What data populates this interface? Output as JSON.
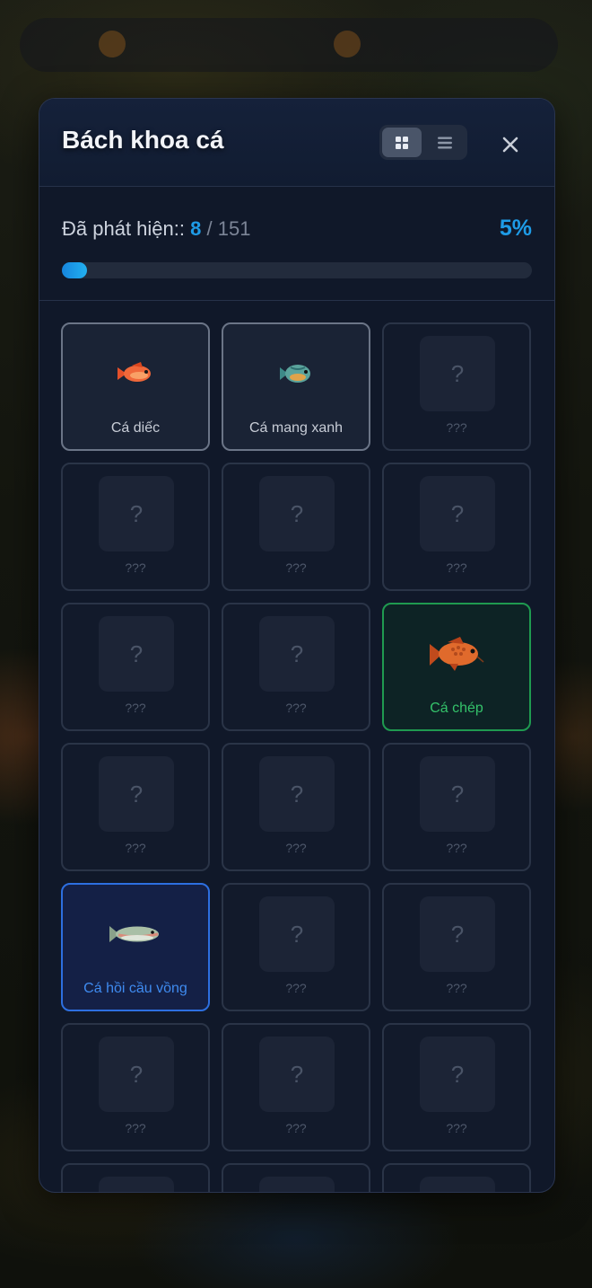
{
  "modal": {
    "title": "Bách khoa cá"
  },
  "progress": {
    "label": "Đã phát hiện::",
    "discovered": "8",
    "separator": "/",
    "total": "151",
    "percent_text": "5%",
    "fraction": 0.05
  },
  "cards": [
    {
      "label": "Cá diếc",
      "state": "found",
      "fish": "small-goldfish"
    },
    {
      "label": "Cá mang xanh",
      "state": "found",
      "fish": "bluegill"
    },
    {
      "label": "???",
      "state": "locked",
      "icon": "?"
    },
    {
      "label": "???",
      "state": "locked",
      "icon": "?"
    },
    {
      "label": "???",
      "state": "locked",
      "icon": "?"
    },
    {
      "label": "???",
      "state": "locked",
      "icon": "?"
    },
    {
      "label": "???",
      "state": "locked",
      "icon": "?"
    },
    {
      "label": "???",
      "state": "locked",
      "icon": "?"
    },
    {
      "label": "Cá chép",
      "state": "green",
      "fish": "carp"
    },
    {
      "label": "???",
      "state": "locked",
      "icon": "?"
    },
    {
      "label": "???",
      "state": "locked",
      "icon": "?"
    },
    {
      "label": "???",
      "state": "locked",
      "icon": "?"
    },
    {
      "label": "Cá hồi cầu vồng",
      "state": "blue",
      "fish": "rainbow-trout"
    },
    {
      "label": "???",
      "state": "locked",
      "icon": "?"
    },
    {
      "label": "???",
      "state": "locked",
      "icon": "?"
    },
    {
      "label": "???",
      "state": "locked",
      "icon": "?"
    },
    {
      "label": "???",
      "state": "locked",
      "icon": "?"
    },
    {
      "label": "???",
      "state": "locked",
      "icon": "?"
    },
    {
      "label": "",
      "state": "locked",
      "icon": ""
    },
    {
      "label": "",
      "state": "locked",
      "icon": ""
    },
    {
      "label": "",
      "state": "locked",
      "icon": ""
    }
  ],
  "icons": {
    "grid_view": "grid-icon",
    "list_view": "list-icon",
    "close": "close-icon"
  },
  "colors": {
    "accent": "#1e9be6",
    "rare_green": "#1f9a50",
    "rare_blue": "#2d6fe0"
  }
}
